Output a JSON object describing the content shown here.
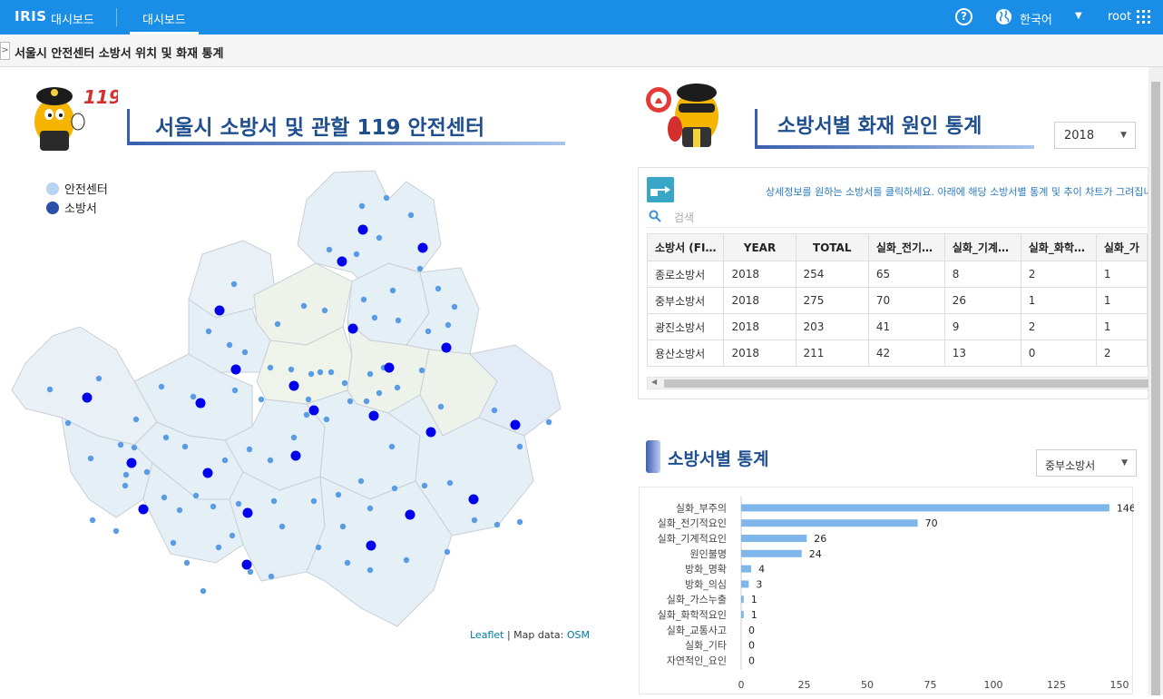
{
  "topbar": {
    "brand": "IRIS",
    "brand_sub": "대시보드",
    "active_tab": "대시보드",
    "help": "?",
    "language": "한국어",
    "user": "root"
  },
  "breadcrumb": {
    "toggle": ">",
    "title": "서울시 안전센터 소방서 위치 및 화재 통계"
  },
  "map_section": {
    "title": "서울시 소방서 및 관할 119 안전센터",
    "legend": [
      {
        "label": "안전센터",
        "color": "#b9d3f2"
      },
      {
        "label": "소방서",
        "color": "#2b4fa8"
      }
    ],
    "attribution_leaflet": "Leaflet",
    "attribution_sep": " | Map data: ",
    "attribution_osm": "OSM",
    "colors": {
      "station": "#0000ee",
      "center": "#5a9be6",
      "district_fill": "#e3eff6",
      "district_stroke": "#c9cfd6"
    }
  },
  "cause_section": {
    "title": "소방서별 화재 원인 통계",
    "year_select": "2018",
    "hint": "상세정보를 원하는 소방서를 클릭하세요. 아래에 해당 소방서별 통계 및 추이 차트가 그려집니다.",
    "search_placeholder": "검색",
    "columns": [
      "소방서 (FI…",
      "YEAR",
      "TOTAL",
      "실화_전기…",
      "실화_기계…",
      "실화_화학…",
      "실화_가"
    ],
    "rows": [
      [
        "종로소방서",
        "2018",
        "254",
        "65",
        "8",
        "2",
        "1"
      ],
      [
        "중부소방서",
        "2018",
        "275",
        "70",
        "26",
        "1",
        "1"
      ],
      [
        "광진소방서",
        "2018",
        "203",
        "41",
        "9",
        "2",
        "1"
      ],
      [
        "용산소방서",
        "2018",
        "211",
        "42",
        "13",
        "0",
        "2"
      ]
    ]
  },
  "station_section": {
    "title": "소방서별 통계",
    "station_select": "중부소방서"
  },
  "chart_data": {
    "type": "bar",
    "orientation": "horizontal",
    "categories": [
      "실화_부주의",
      "실화_전기적요인",
      "실화_기계적요인",
      "원인불명",
      "방화_명확",
      "방화_의심",
      "실화_가스누출",
      "실화_화학적요인",
      "실화_교통사고",
      "실화_기타",
      "자연적인_요인"
    ],
    "values": [
      146,
      70,
      26,
      24,
      4,
      3,
      1,
      1,
      0,
      0,
      0
    ],
    "value_labels": [
      "146",
      "70",
      "26",
      "24",
      "4",
      "3",
      "1",
      "1",
      "0",
      "0",
      "0"
    ],
    "xlim": [
      0,
      150
    ],
    "xticks": [
      0,
      25,
      50,
      75,
      100,
      125,
      150
    ],
    "bar_color": "#7eb6ea",
    "grid": false,
    "legend": "none"
  }
}
